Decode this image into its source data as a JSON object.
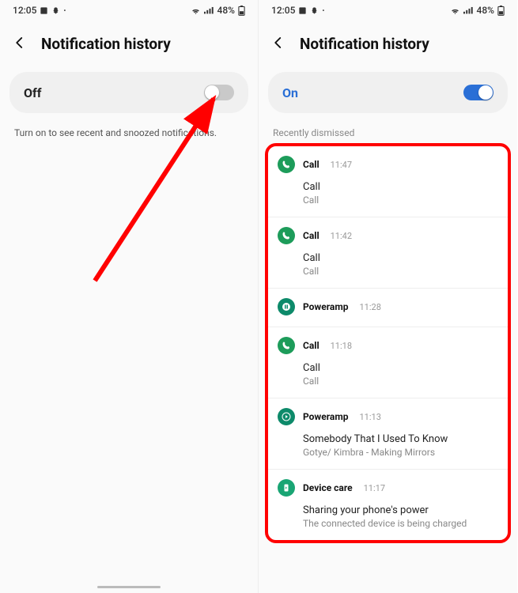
{
  "status": {
    "time": "12:05",
    "battery": "48%"
  },
  "header": {
    "title": "Notification history"
  },
  "left": {
    "toggleLabel": "Off",
    "helper": "Turn on to see recent and snoozed notifications."
  },
  "right": {
    "toggleLabel": "On",
    "sectionLabel": "Recently dismissed",
    "items": [
      {
        "app": "Call",
        "time": "11:47",
        "title": "Call",
        "sub": "Call",
        "iconType": "call"
      },
      {
        "app": "Call",
        "time": "11:42",
        "title": "Call",
        "sub": "Call",
        "iconType": "call"
      },
      {
        "app": "Poweramp",
        "time": "11:28",
        "title": "",
        "sub": "",
        "iconType": "poweramp"
      },
      {
        "app": "Call",
        "time": "11:18",
        "title": "Call",
        "sub": "Call",
        "iconType": "call"
      },
      {
        "app": "Poweramp",
        "time": "11:13",
        "title": "Somebody That I Used To Know",
        "sub": "Gotye/ Kimbra - Making Mirrors",
        "iconType": "poweramp-play"
      },
      {
        "app": "Device care",
        "time": "11:17",
        "title": "Sharing your phone's power",
        "sub": "The connected device is being charged",
        "iconType": "devicecare"
      }
    ]
  }
}
